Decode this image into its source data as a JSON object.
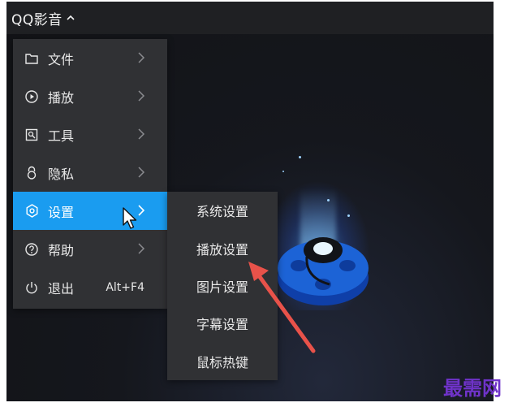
{
  "app": {
    "title": "QQ影音"
  },
  "menu": {
    "items": [
      {
        "label": "文件",
        "icon": "folder-icon",
        "has_submenu": true
      },
      {
        "label": "播放",
        "icon": "play-circle-icon",
        "has_submenu": true
      },
      {
        "label": "工具",
        "icon": "tools-icon",
        "has_submenu": true
      },
      {
        "label": "隐私",
        "icon": "lock-icon",
        "has_submenu": true
      },
      {
        "label": "设置",
        "icon": "gear-icon",
        "has_submenu": true,
        "active": true
      },
      {
        "label": "帮助",
        "icon": "help-circle-icon",
        "has_submenu": true
      },
      {
        "label": "退出",
        "icon": "power-icon",
        "shortcut": "Alt+F4"
      }
    ]
  },
  "submenu": {
    "items": [
      {
        "label": "系统设置"
      },
      {
        "label": "播放设置"
      },
      {
        "label": "图片设置"
      },
      {
        "label": "字幕设置"
      },
      {
        "label": "鼠标热键"
      }
    ]
  },
  "watermark": {
    "text": "最需网"
  },
  "colors": {
    "accent": "#1a9cf0",
    "menu_bg": "#303134",
    "annotation_arrow": "#e8524a",
    "watermark": "#6f33c9"
  }
}
